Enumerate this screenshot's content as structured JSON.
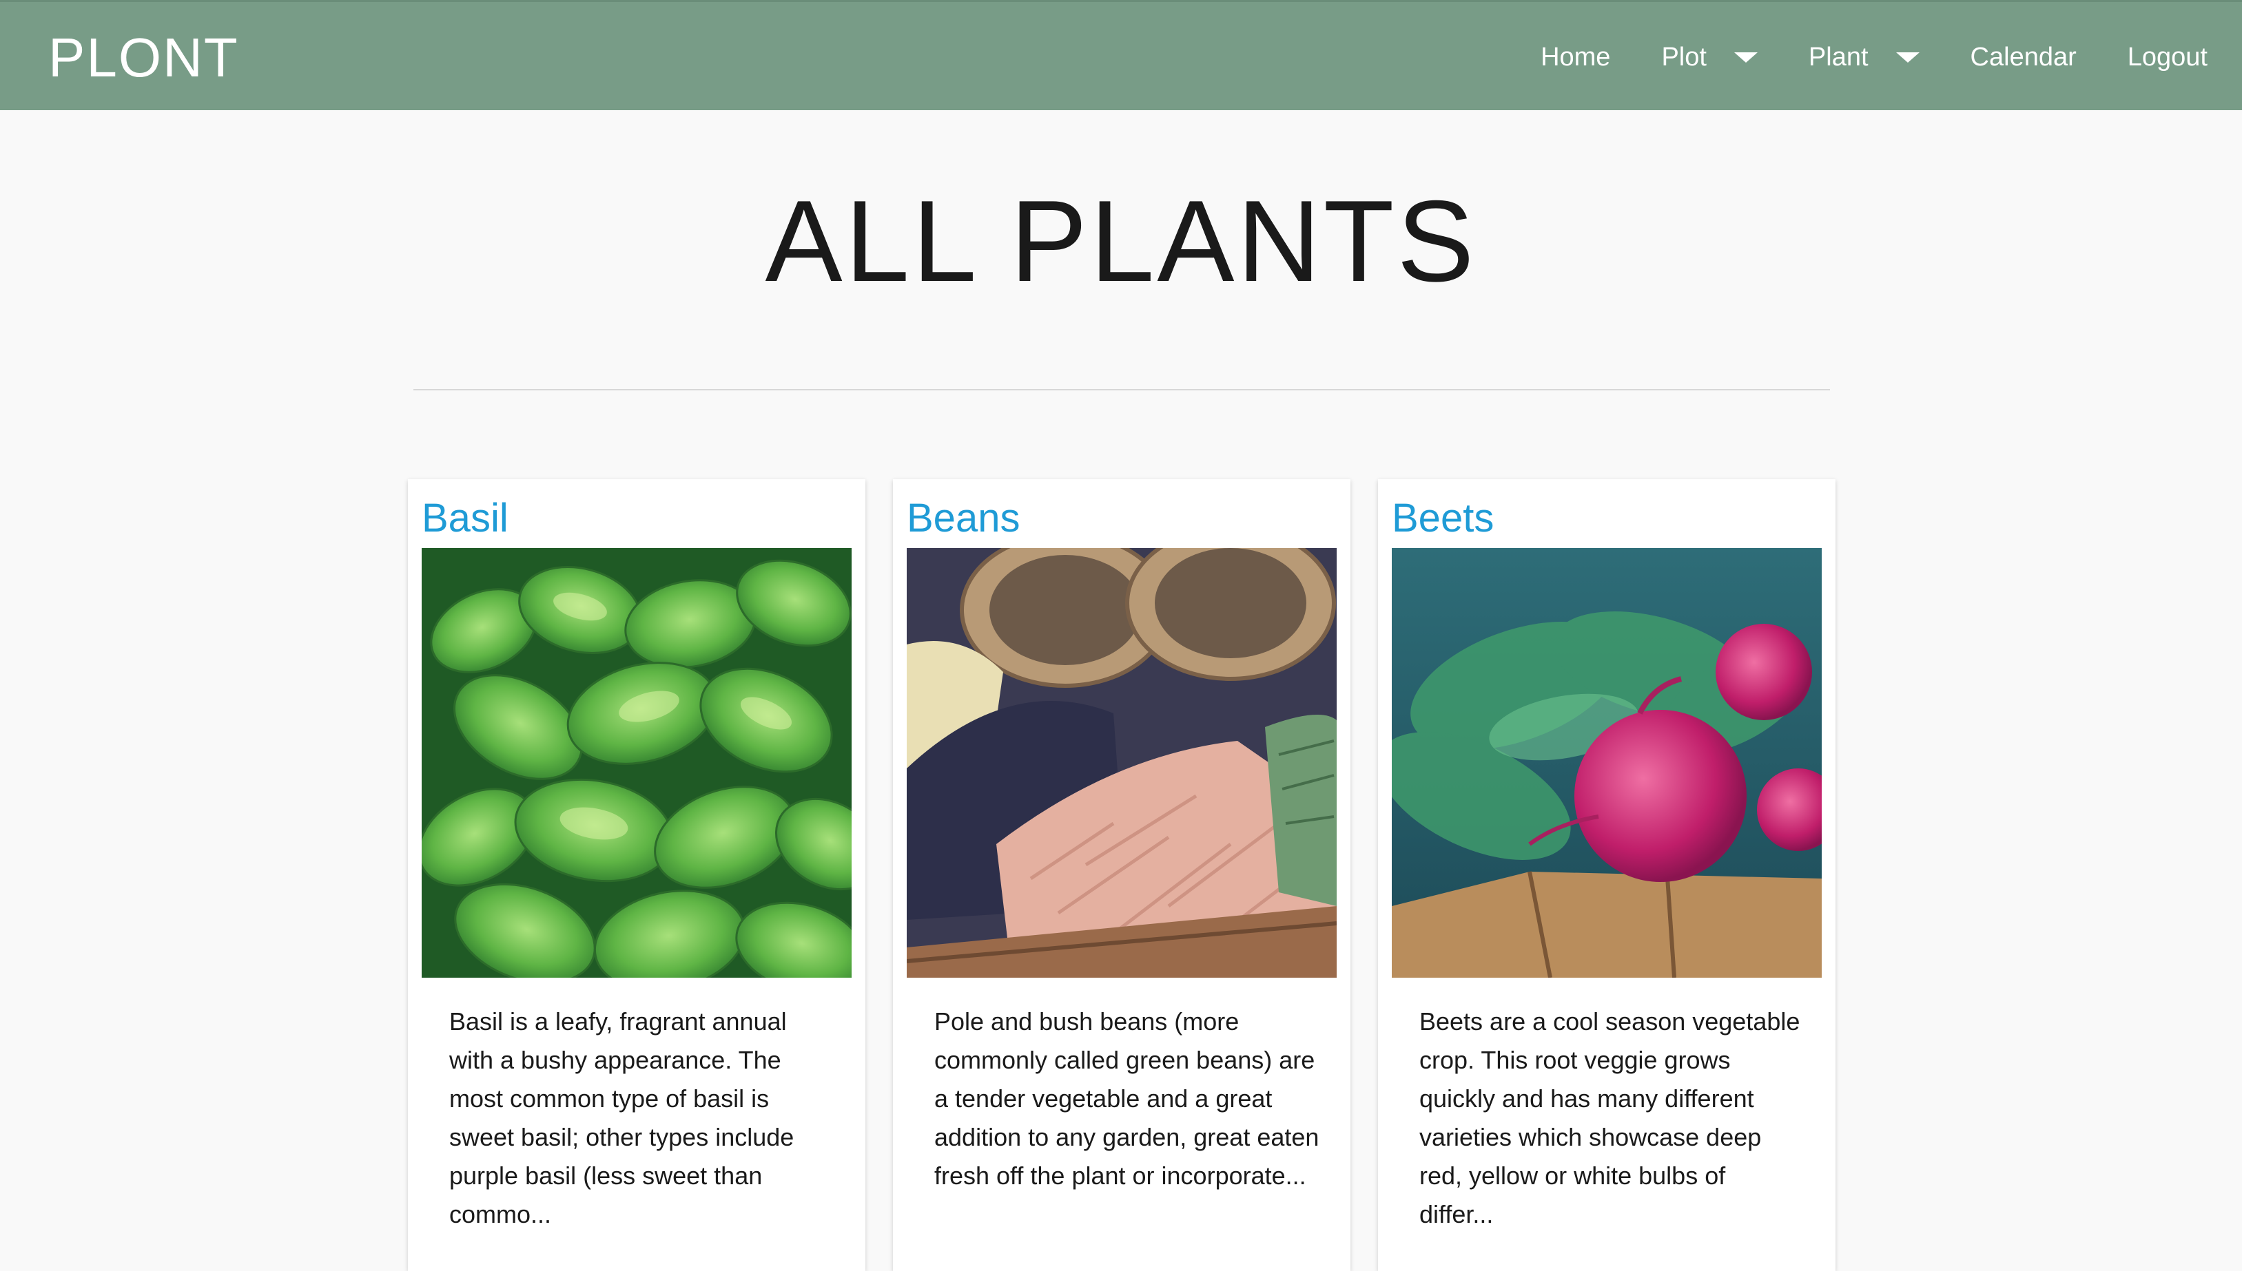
{
  "navbar": {
    "brand": "PLONT",
    "links": [
      {
        "label": "Home"
      },
      {
        "label": "Plot",
        "dropdown": true
      },
      {
        "label": "Plant",
        "dropdown": true
      },
      {
        "label": "Calendar"
      },
      {
        "label": "Logout"
      }
    ],
    "background": "#789c87"
  },
  "page": {
    "title": "ALL PLANTS"
  },
  "cards": [
    {
      "title": "Basil",
      "image": "basil-photo",
      "description": "Basil is a leafy, fragrant annual with a bushy appearance. The most common type of basil is sweet basil; other types include purple basil (less sweet than commo..."
    },
    {
      "title": "Beans",
      "image": "beans-photo",
      "description": "Pole and bush beans (more commonly called green beans) are a tender vegetable and a great addition to any garden, great eaten fresh off the plant or incorporate..."
    },
    {
      "title": "Beets",
      "image": "beets-photo",
      "description": "Beets are a cool season vegetable crop. This root veggie grows quickly and has many different varieties which showcase deep red, yellow or white bulbs of differ..."
    }
  ],
  "colors": {
    "card_title": "#1f9bd6",
    "page_background": "#f9f9f9"
  }
}
